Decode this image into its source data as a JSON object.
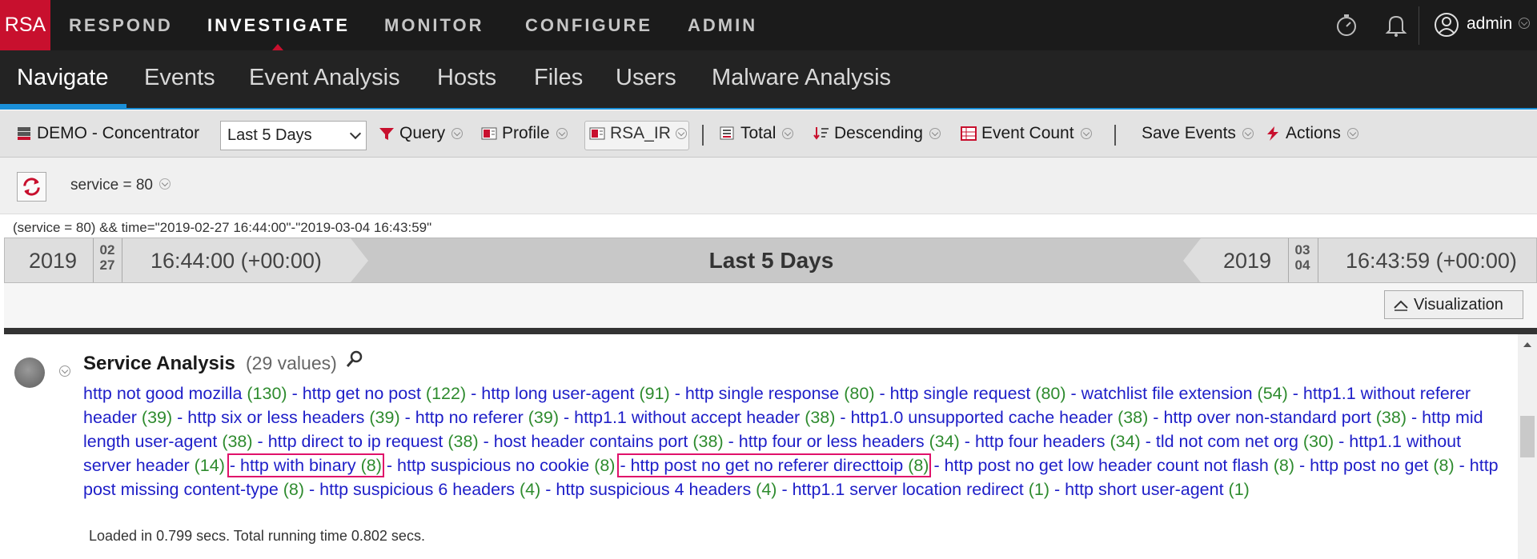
{
  "topnav": {
    "logo": "RSA",
    "items": [
      "RESPOND",
      "INVESTIGATE",
      "MONITOR",
      "CONFIGURE",
      "ADMIN"
    ],
    "active": "INVESTIGATE",
    "user": "admin",
    "icons": [
      "stopwatch-icon",
      "bell-icon",
      "user-icon"
    ]
  },
  "subnav": {
    "items": [
      "Navigate",
      "Events",
      "Event Analysis",
      "Hosts",
      "Files",
      "Users",
      "Malware Analysis"
    ],
    "active": "Navigate"
  },
  "toolbar": {
    "service": "DEMO - Concentrator",
    "time_range": "Last 5 Days",
    "query": "Query",
    "profile": "Profile",
    "profile_value": "RSA_IR",
    "total": "Total",
    "sort": "Descending",
    "count": "Event Count",
    "save_events": "Save Events",
    "actions": "Actions"
  },
  "query": {
    "breadcrumb": "service = 80",
    "string": "(service = 80) && time=\"2019-02-27 16:44:00\"-\"2019-03-04 16:43:59\""
  },
  "timebar": {
    "start_year": "2019",
    "start_month": "02",
    "start_day": "27",
    "start_time": "16:44:00 (+00:00)",
    "range": "Last 5 Days",
    "end_year": "2019",
    "end_month": "03",
    "end_day": "04",
    "end_time": "16:43:59 (+00:00)"
  },
  "visualization_label": "Visualization",
  "service_analysis": {
    "title": "Service Analysis",
    "count": "(29 values)",
    "values": [
      {
        "name": "http not good mozilla",
        "count": "(130)"
      },
      {
        "name": "http get no post",
        "count": "(122)"
      },
      {
        "name": "http long user-agent",
        "count": "(91)"
      },
      {
        "name": "http single response",
        "count": "(80)"
      },
      {
        "name": "http single request",
        "count": "(80)"
      },
      {
        "name": "watchlist file extension",
        "count": "(54)"
      },
      {
        "name": "http1.1 without referer header",
        "count": "(39)"
      },
      {
        "name": "http six or less headers",
        "count": "(39)"
      },
      {
        "name": "http no referer",
        "count": "(39)"
      },
      {
        "name": "http1.1 without accept header",
        "count": "(38)"
      },
      {
        "name": "http1.0 unsupported cache header",
        "count": "(38)"
      },
      {
        "name": "http over non-standard port",
        "count": "(38)"
      },
      {
        "name": "http mid length user-agent",
        "count": "(38)"
      },
      {
        "name": "http direct to ip request",
        "count": "(38)"
      },
      {
        "name": "host header contains port",
        "count": "(38)"
      },
      {
        "name": "http four or less headers",
        "count": "(34)"
      },
      {
        "name": "http four headers",
        "count": "(34)"
      },
      {
        "name": "tld not com net org",
        "count": "(30)"
      },
      {
        "name": "http1.1 without server header",
        "count": "(14)"
      },
      {
        "name": "http with binary",
        "count": "(8)",
        "highlight": true
      },
      {
        "name": "http suspicious no cookie",
        "count": "(8)"
      },
      {
        "name": "http post no get no referer directtoip",
        "count": "(8)",
        "highlight": true
      },
      {
        "name": "http post no get low header count not flash",
        "count": "(8)"
      },
      {
        "name": "http post no get",
        "count": "(8)"
      },
      {
        "name": "http post missing content-type",
        "count": "(8)"
      },
      {
        "name": "http suspicious 6 headers",
        "count": "(4)"
      },
      {
        "name": "http suspicious 4 headers",
        "count": "(4)"
      },
      {
        "name": "http1.1 server location redirect",
        "count": "(1)"
      },
      {
        "name": "http short user-agent",
        "count": "(1)"
      }
    ],
    "loaded": "Loaded in 0.799 secs. Total running time 0.802 secs."
  },
  "colors": {
    "brand": "#c8102e",
    "link": "#1e1ec8",
    "count": "#2e8b2e",
    "highlight": "#e0116a",
    "accent": "#1a8fd8"
  }
}
